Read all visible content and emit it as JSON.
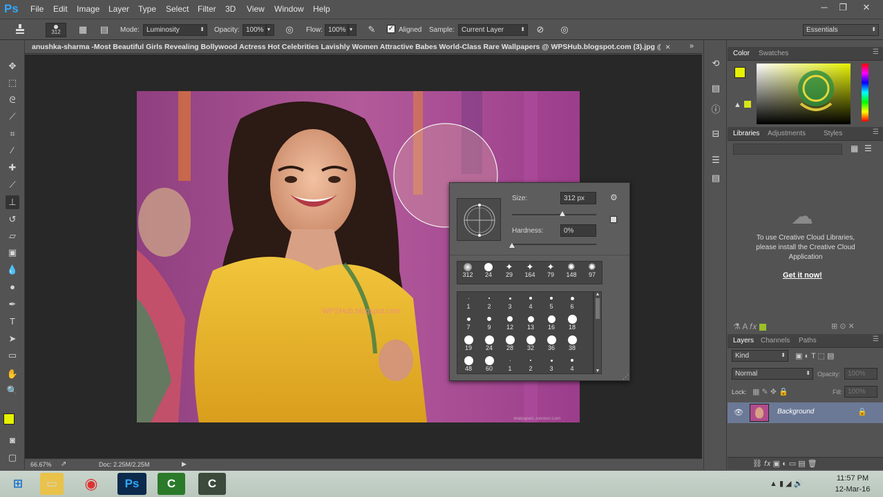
{
  "app": {
    "logo": "Ps"
  },
  "menu": [
    "File",
    "Edit",
    "Image",
    "Layer",
    "Type",
    "Select",
    "Filter",
    "3D",
    "View",
    "Window",
    "Help"
  ],
  "window_controls": {
    "minimize": "─",
    "restore": "❐",
    "close": "✕"
  },
  "options": {
    "brush_size": "312",
    "mode_label": "Mode:",
    "mode_value": "Luminosity",
    "opacity_label": "Opacity:",
    "opacity_value": "100%",
    "flow_label": "Flow:",
    "flow_value": "100%",
    "aligned_label": "Aligned",
    "aligned_checked": true,
    "sample_label": "Sample:",
    "sample_value": "Current Layer",
    "workspace": "Essentials"
  },
  "document": {
    "tab_title": "anushka-sharma -Most Beautiful Girls Revealing Bollywood Actress Hot Celebrities Lavishly Women Attractive Babes World-Class Rare Wallpapers @ WPSHub.blogspot.com (3).jpg @ 6...",
    "tab_close": "×",
    "watermark": "WPSHub.blogspot.com",
    "corner_credit": "Wallpapers Junction.Com"
  },
  "status": {
    "zoom": "66.67%",
    "doc": "Doc: 2.25M/2.25M"
  },
  "brush_picker": {
    "size_label": "Size:",
    "size_value": "312 px",
    "hardness_label": "Hardness:",
    "hardness_value": "0%",
    "size_fraction": 0.4,
    "hardness_fraction": 0.0,
    "top_presets": [
      "312",
      "24",
      "29",
      "164",
      "79",
      "148",
      "97"
    ],
    "grid_rows": [
      [
        "1",
        "2",
        "3",
        "4",
        "5",
        "6"
      ],
      [
        "7",
        "9",
        "12",
        "13",
        "16",
        "18"
      ],
      [
        "19",
        "24",
        "28",
        "32",
        "36",
        "38"
      ],
      [
        "48",
        "60",
        "1",
        "2",
        "3",
        "4"
      ]
    ]
  },
  "color_panel": {
    "tabs": [
      "Color",
      "Swatches"
    ],
    "foreground": "#e6f200",
    "background": "#1fb21f"
  },
  "libraries_panel": {
    "tabs": [
      "Libraries",
      "Adjustments",
      "Styles"
    ],
    "message": "To use Creative Cloud Libraries, please install the Creative Cloud Application",
    "link": "Get it now!"
  },
  "layers_panel": {
    "tabs": [
      "Layers",
      "Channels",
      "Paths"
    ],
    "filter_kind": "Kind",
    "blend_mode": "Normal",
    "opacity_label": "Opacity:",
    "opacity_value": "100%",
    "lock_label": "Lock:",
    "fill_label": "Fill:",
    "fill_value": "100%",
    "layers": [
      {
        "name": "Background"
      }
    ]
  },
  "taskbar": {
    "time": "11:57 PM",
    "date": "12-Mar-16"
  },
  "colors": {
    "accent": "#31a8ff",
    "canvas_bg": "#282828",
    "panel_bg": "#535353"
  }
}
